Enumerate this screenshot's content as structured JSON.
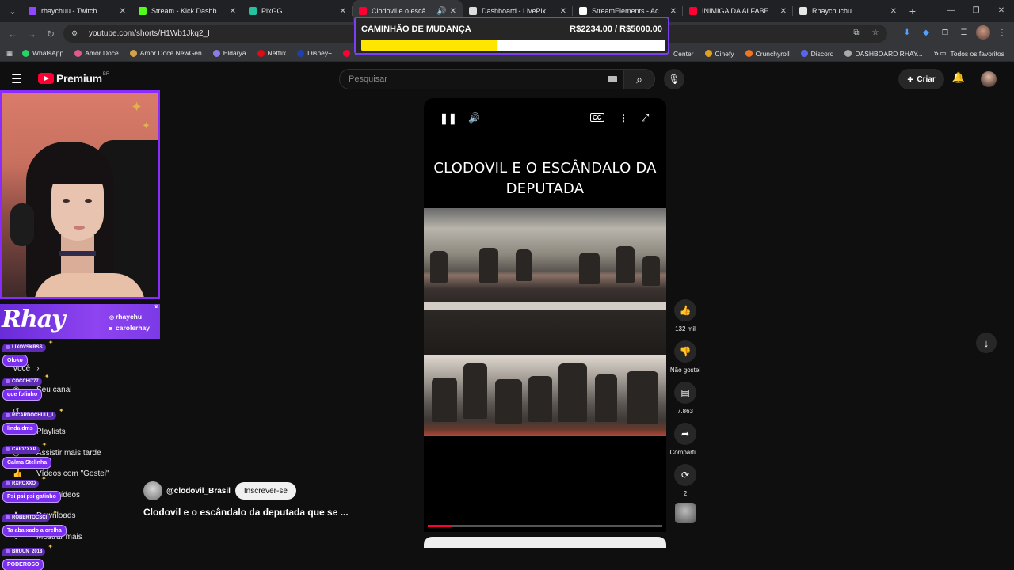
{
  "browser": {
    "tabs": [
      {
        "title": "rhaychuu - Twitch",
        "color": "#9146ff",
        "active": false
      },
      {
        "title": "Stream - Kick Dashboard",
        "color": "#53fc18",
        "active": false
      },
      {
        "title": "PixGG",
        "color": "#25c2a0",
        "active": false
      },
      {
        "title": "Clodovil e o escândalo",
        "color": "#ff0033",
        "active": true
      },
      {
        "title": "Dashboard - LivePix",
        "color": "#dddddd",
        "active": false
      },
      {
        "title": "StreamElements - Activity",
        "color": "#ffffff",
        "active": false
      },
      {
        "title": "INIMIGA DA ALFABETIZAÇ",
        "color": "#ff0033",
        "active": false
      },
      {
        "title": "Rhaychuchu",
        "color": "#e6e6e6",
        "active": false
      }
    ],
    "url": "youtube.com/shorts/H1Wb1Jkq2_I",
    "bookmarks_left": [
      {
        "label": "WhatsApp",
        "color": "#25d366"
      },
      {
        "label": "Amor Doce",
        "color": "#e05a8a"
      },
      {
        "label": "Amor Doce NewGen",
        "color": "#d4a24c"
      },
      {
        "label": "Eldarya",
        "color": "#8f7be8"
      },
      {
        "label": "Netflix",
        "color": "#e50914"
      },
      {
        "label": "Disney+",
        "color": "#1f3fae"
      },
      {
        "label": "Yo",
        "color": "#ff0033"
      }
    ],
    "bookmarks_right": [
      {
        "label": "Center",
        "color": "#35363a"
      },
      {
        "label": "Cinefy",
        "color": "#e0a020"
      },
      {
        "label": "Crunchyroll",
        "color": "#f47521"
      },
      {
        "label": "Discord",
        "color": "#5865f2"
      },
      {
        "label": "DASHBOARD RHAY...",
        "color": "#aaaaaa"
      }
    ],
    "all_bookmarks": "Todos os favoritos"
  },
  "goal": {
    "title": "CAMINHÃO DE MUDANÇA",
    "amount": "R$2234.00 / R$5000.00",
    "progress": 0.4468
  },
  "youtube": {
    "brand": "Premium",
    "country": "BR",
    "search_placeholder": "Pesquisar",
    "create_label": "Criar"
  },
  "sidenav": {
    "items": [
      "Você",
      "Seu canal",
      "Playlists",
      "Assistir mais tarde",
      "Vídeos com \"Gostei\"",
      "Seus vídeos",
      "Downloads",
      "Mostrar mais"
    ]
  },
  "overlay": {
    "banner_name": "Rhay",
    "handles": [
      "rhaychu",
      "carolerhay"
    ]
  },
  "chat": [
    {
      "user": "LIXOVSKRSS",
      "msg": "Oloko"
    },
    {
      "user": "COCCHI777",
      "msg": "que fofinho"
    },
    {
      "user": "RICARDOCHUU_II",
      "msg": "linda dms"
    },
    {
      "user": "CAIOZXXP",
      "msg": "Calma Stelinha"
    },
    {
      "user": "RXROXXO",
      "msg": "Psi psi psi gatinho"
    },
    {
      "user": "ROBERTOCSCI",
      "msg": "Ta abaixado a orelha"
    },
    {
      "user": "BRUUN_2018",
      "msg": "PODEROSO"
    }
  ],
  "video": {
    "overlay_title": "CLODOVIL E O ESCÂNDALO DA DEPUTADA",
    "channel": "@clodovil_Brasil",
    "subscribe": "Inscrever-se",
    "title": "Clodovil e o escândalo da deputada que se ...",
    "progress": 0.1
  },
  "actions": {
    "likes": "132 mil",
    "dislike": "Não gostei",
    "comments": "7.863",
    "share": "Comparti...",
    "remix": "2"
  }
}
